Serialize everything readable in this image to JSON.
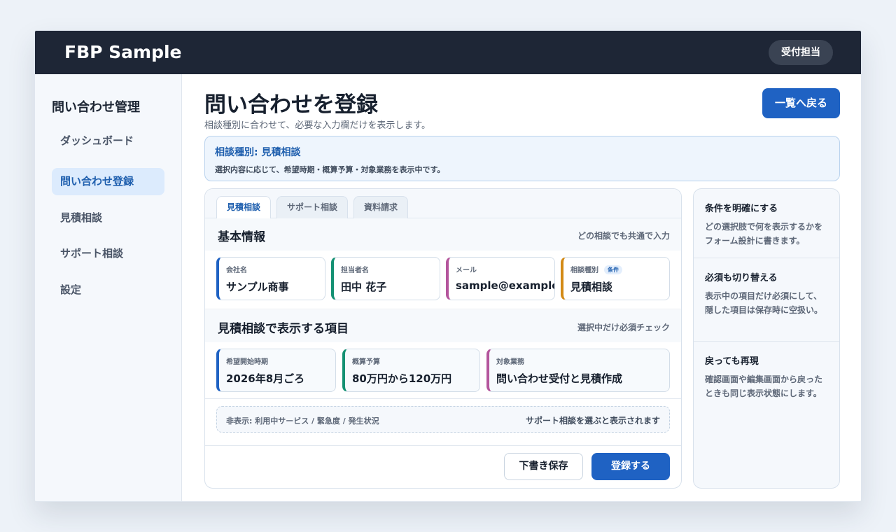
{
  "header": {
    "brand": "FBP Sample",
    "role": "受付担当"
  },
  "sidebar": {
    "title": "問い合わせ管理",
    "items": [
      {
        "label": "ダッシュボード",
        "active": false
      },
      {
        "label": "問い合わせ登録",
        "active": true
      },
      {
        "label": "見積相談",
        "active": false
      },
      {
        "label": "サポート相談",
        "active": false
      },
      {
        "label": "設定",
        "active": false
      }
    ]
  },
  "page": {
    "title": "問い合わせを登録",
    "subtitle": "相談種別に合わせて、必要な入力欄だけを表示します。",
    "back_label": "一覧へ戻る"
  },
  "banner": {
    "title": "相談種別: 見積相談",
    "text": "選択内容に応じて、希望時期・概算予算・対象業務を表示中です。"
  },
  "tabs": [
    "見積相談",
    "サポート相談",
    "資料請求"
  ],
  "basic": {
    "title": "基本情報",
    "note": "どの相談でも共通で入力",
    "fields": [
      {
        "label": "会社名",
        "value": "サンプル商事"
      },
      {
        "label": "担当者名",
        "value": "田中 花子"
      },
      {
        "label": "メール",
        "value": "sample@example.jp"
      },
      {
        "label": "相談種別",
        "value": "見積相談",
        "badge": "条件"
      }
    ]
  },
  "estimate": {
    "title": "見積相談で表示する項目",
    "note": "選択中だけ必須チェック",
    "fields": [
      {
        "label": "希望開始時期",
        "value": "2026年8月ごろ"
      },
      {
        "label": "概算予算",
        "value": "80万円から120万円"
      },
      {
        "label": "対象業務",
        "value": "問い合わせ受付と見積作成"
      }
    ]
  },
  "hidden": {
    "left": "非表示: 利用中サービス / 緊急度 / 発生状況",
    "right": "サポート相談を選ぶと表示されます"
  },
  "actions": {
    "draft": "下書き保存",
    "submit": "登録する"
  },
  "tips": [
    {
      "title": "条件を明確にする",
      "text": "どの選択肢で何を表示するかをフォーム設計に書きます。"
    },
    {
      "title": "必須も切り替える",
      "text": "表示中の項目だけ必須にして、隠した項目は保存時に空扱い。"
    },
    {
      "title": "戻っても再現",
      "text": "確認画面や編集画面から戻ったときも同じ表示状態にします。"
    }
  ],
  "colors": {
    "accent": "#1f62c3",
    "topbar": "#1e2636",
    "field_blue": "#1f62c3",
    "field_green": "#149173",
    "field_purple": "#b4559c",
    "field_orange": "#d38a16"
  }
}
